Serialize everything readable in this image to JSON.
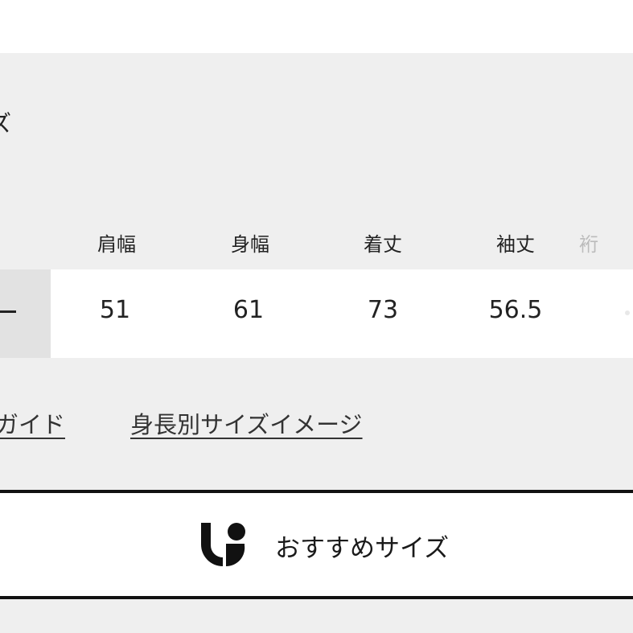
{
  "heading_fragment": "ズ",
  "size_table": {
    "headers": [
      "肩幅",
      "身幅",
      "着丈",
      "袖丈",
      "裄"
    ],
    "rows": [
      {
        "label": "ー",
        "values": [
          "51",
          "61",
          "73",
          "56.5",
          ""
        ]
      }
    ]
  },
  "links": {
    "size_guide": "ガイド",
    "height_image": "身長別サイズイメージ"
  },
  "recommend": {
    "label": "おすすめサイズ",
    "icon": "uniqlo-fit-icon"
  }
}
